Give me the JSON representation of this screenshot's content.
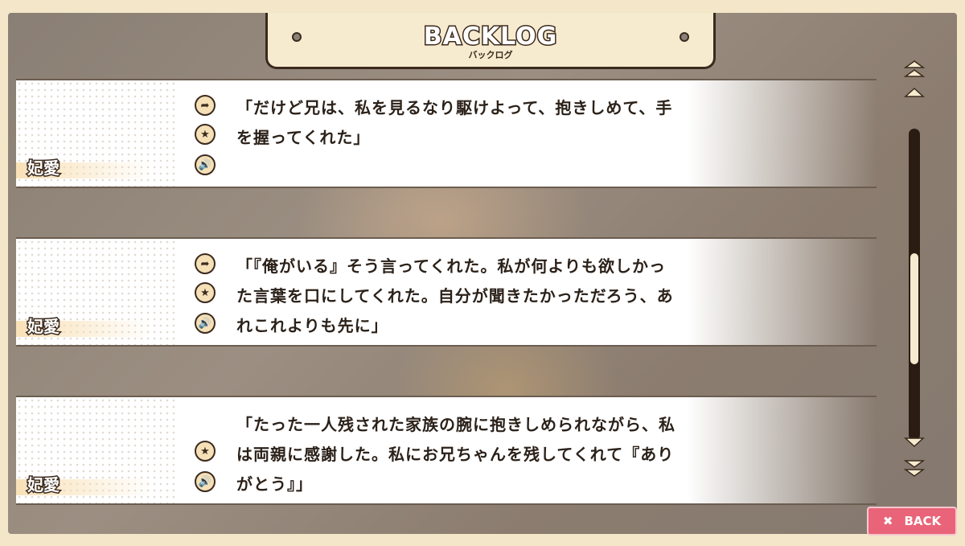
{
  "header": {
    "title": "BACKLOG",
    "subtitle": "バックログ"
  },
  "entries": [
    {
      "speaker": "妃愛",
      "lines": [
        "「だけど兄は、私を見るなり駆けよって、抱きしめて、手",
        "を握ってくれた」"
      ],
      "icons": [
        "jump-icon",
        "star-icon",
        "voice-icon"
      ]
    },
    {
      "speaker": "妃愛",
      "lines": [
        "「『俺がいる』そう言ってくれた。私が何よりも欲しかっ",
        "た言葉を口にしてくれた。自分が聞きたかっただろう、あ",
        "れこれよりも先に」"
      ],
      "icons": [
        "jump-icon",
        "star-icon",
        "voice-icon"
      ]
    },
    {
      "speaker": "妃愛",
      "lines": [
        "「たった一人残された家族の腕に抱きしめられながら、私",
        "は両親に感謝した。私にお兄ちゃんを残してくれて『あり",
        "がとう』」"
      ],
      "icons": [
        "star-icon",
        "voice-icon"
      ]
    }
  ],
  "scrollbar": {
    "position": 0.62,
    "visible_fraction": 0.36
  },
  "back_button": {
    "label": "BACK",
    "icon": "close-icon"
  },
  "colors": {
    "accent": "#e96478",
    "panel": "#f7ebcf",
    "outline": "#3b2a1e"
  }
}
